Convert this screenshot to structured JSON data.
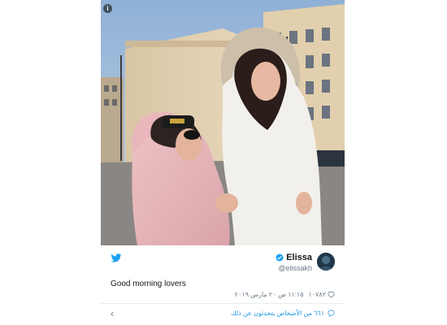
{
  "tweet": {
    "display_name": "Elissa",
    "handle": "@elissakh",
    "text": "Good morning lovers",
    "likes": "١٠٧٨٢",
    "timestamp": "١١:١٥ ص - ٢ مارس ٢٠١٩",
    "people_talking": "٦٦١ من الأشخاص يتحدثون عن ذلك",
    "back_glyph": "‹",
    "info_glyph": "i"
  },
  "colors": {
    "twitter_blue": "#1da1f2",
    "link_blue": "#1b95e0",
    "text": "#14171a",
    "muted": "#657786"
  },
  "icons": {
    "brand": "twitter-bird-icon",
    "verified": "verified-badge-icon",
    "like": "heart-icon",
    "conversation": "speech-bubble-icon",
    "info": "info-icon",
    "back": "chevron-left-icon"
  }
}
